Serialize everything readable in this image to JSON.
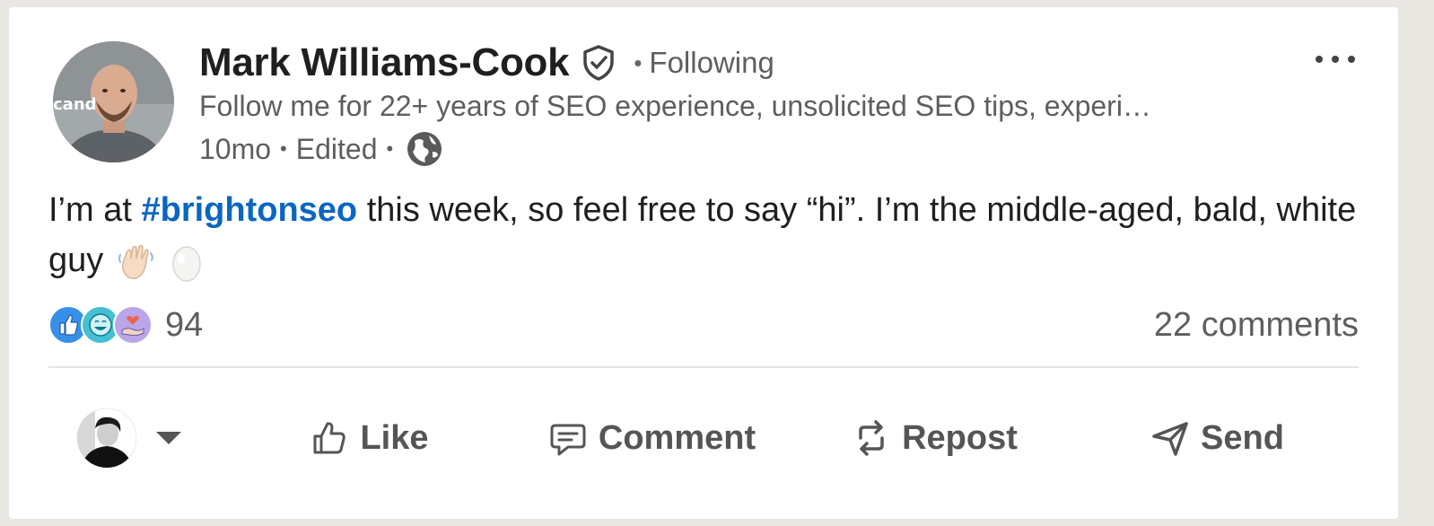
{
  "post": {
    "author": {
      "name": "Mark Williams-Cook",
      "follow_status": "Following",
      "headline": "Follow me for 22+ years of SEO experience, unsolicited SEO tips, experi…",
      "avatar_shirt_text": "cand"
    },
    "meta": {
      "age": "10mo",
      "edited": "Edited",
      "visibility_icon": "globe-icon"
    },
    "body": {
      "prefix": "I’m at ",
      "hashtag": "#brightonseo",
      "suffix": " this week, so feel free to say “hi”. I’m the middle-aged, bald, white guy",
      "emojis": [
        "waving-hand-icon",
        "egg-icon"
      ]
    },
    "social": {
      "reaction_icons": [
        "like-reaction-icon",
        "funny-reaction-icon",
        "support-reaction-icon"
      ],
      "reaction_count": "94",
      "comments": "22 comments"
    },
    "actions": {
      "like": "Like",
      "comment": "Comment",
      "repost": "Repost",
      "send": "Send"
    }
  },
  "colors": {
    "link": "#0a66c2",
    "text_primary": "#1f1f1f",
    "text_secondary": "#5e5e5e",
    "page_bg": "#e9e7e1",
    "card_bg": "#ffffff"
  }
}
